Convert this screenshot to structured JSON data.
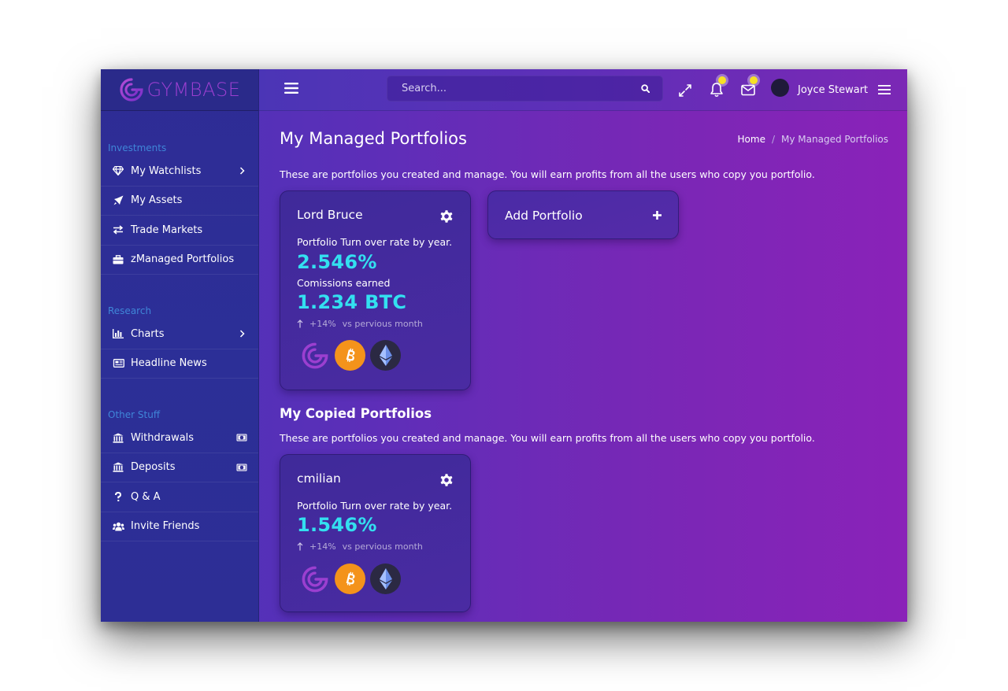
{
  "brand": {
    "name": "GYMBASE"
  },
  "header": {
    "search_placeholder": "Search...",
    "user_name": "Joyce Stewart",
    "icons": [
      "menu-icon",
      "search-icon",
      "fullscreen-icon",
      "bell-icon",
      "mail-icon",
      "avatar",
      "menu-icon"
    ]
  },
  "sidebar": {
    "sections": [
      {
        "title": "Investments",
        "items": [
          {
            "label": "My Watchlists",
            "icon": "diamond-icon",
            "right": "chevron-right-icon"
          },
          {
            "label": "My Assets",
            "icon": "rocket-icon"
          },
          {
            "label": "Trade Markets",
            "icon": "exchange-icon"
          },
          {
            "label": "zManaged Portfolios",
            "icon": "briefcase-icon"
          }
        ]
      },
      {
        "title": "Research",
        "items": [
          {
            "label": "Charts",
            "icon": "bar-chart-icon",
            "right": "chevron-right-icon"
          },
          {
            "label": "Headline News",
            "icon": "newspaper-icon"
          }
        ]
      },
      {
        "title": "Other Stuff",
        "items": [
          {
            "label": "Withdrawals",
            "icon": "bank-icon",
            "right": "money-icon"
          },
          {
            "label": "Deposits",
            "icon": "bank-icon",
            "right": "money-icon"
          },
          {
            "label": "Q & A",
            "icon": "question-icon"
          },
          {
            "label": "Invite Friends",
            "icon": "users-icon"
          }
        ]
      }
    ]
  },
  "main": {
    "title": "My Managed Portfolios",
    "breadcrumb": {
      "home": "Home",
      "sep": "/",
      "current": "My Managed Portfolios"
    },
    "managed_desc": "These are portfolios you created and manage. You will earn profits from all the users who copy you portfolio.",
    "managed_cards": [
      {
        "name": "Lord Bruce",
        "turnover_label": "Portfolio Turn over rate by year.",
        "turnover_value": "2.546%",
        "commission_label": "Comissions earned",
        "commission_value": "1.234 BTC",
        "trend_value": "+14%",
        "trend_label": "vs pervious month"
      }
    ],
    "add_portfolio_label": "Add Portfolio",
    "copied_title": "My Copied Portfolios",
    "copied_desc": "These are portfolios you created and manage. You will earn profits from all the users who copy you portfolio.",
    "copied_cards": [
      {
        "name": "cmilian",
        "turnover_label": "Portfolio Turn over rate by year.",
        "turnover_value": "1.546%",
        "trend_value": "+14%",
        "trend_label": "vs pervious month"
      }
    ]
  },
  "colors": {
    "accent_value": "#33e0f0",
    "section_title": "#3f86d8",
    "btc": "#f4931b",
    "notify_dot": "#f7e026"
  }
}
